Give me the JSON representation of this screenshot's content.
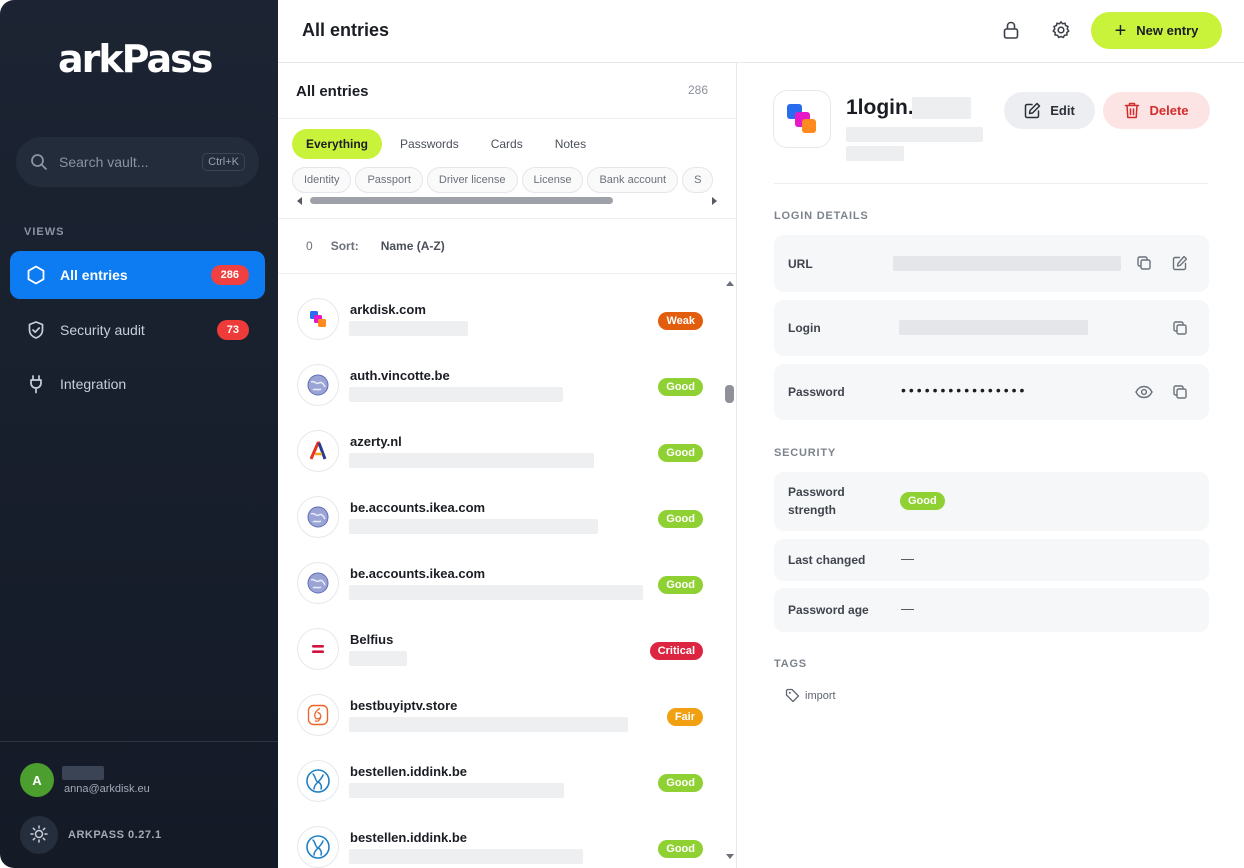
{
  "app": {
    "logo_text": "arkPass",
    "version": "ARKPASS 0.27.1"
  },
  "sidebar": {
    "search_placeholder": "Search vault...",
    "search_shortcut": "Ctrl+K",
    "views_label": "VIEWS",
    "items": [
      {
        "label": "All entries",
        "count": "286",
        "icon": "hexagon-icon",
        "active": true
      },
      {
        "label": "Security audit",
        "count": "73",
        "icon": "shield-check-icon",
        "active": false
      },
      {
        "label": "Integration",
        "count": "",
        "icon": "plug-icon",
        "active": false
      }
    ],
    "user": {
      "avatar_letter": "A",
      "email": "anna@arkdisk.eu"
    }
  },
  "header": {
    "title": "All entries",
    "new_entry_label": "New entry",
    "lock_icon": "lock-icon",
    "settings_icon": "gear-icon"
  },
  "list": {
    "title": "All entries",
    "count": "286",
    "tabs": [
      "Everything",
      "Passwords",
      "Cards",
      "Notes"
    ],
    "active_tab": "Everything",
    "chips": [
      "Identity",
      "Passport",
      "Driver license",
      "License",
      "Bank account",
      "S"
    ],
    "sort": {
      "zero": "0",
      "label": "Sort:",
      "value": "Name (A-Z)"
    },
    "entries": [
      {
        "title": "arkdisk.com",
        "strength": "Weak",
        "icon": "arkdisk-logo-icon"
      },
      {
        "title": "auth.vincotte.be",
        "strength": "Good",
        "icon": "globe-icon"
      },
      {
        "title": "azerty.nl",
        "strength": "Good",
        "icon": "azerty-logo-icon"
      },
      {
        "title": "be.accounts.ikea.com",
        "strength": "Good",
        "icon": "globe-icon"
      },
      {
        "title": "be.accounts.ikea.com",
        "strength": "Good",
        "icon": "globe-icon"
      },
      {
        "title": "Belfius",
        "strength": "Critical",
        "icon": "belfius-logo-icon"
      },
      {
        "title": "bestbuyiptv.store",
        "strength": "Fair",
        "icon": "bestbuy-logo-icon"
      },
      {
        "title": "bestellen.iddink.be",
        "strength": "Good",
        "icon": "iddink-logo-icon"
      },
      {
        "title": "bestellen.iddink.be",
        "strength": "Good",
        "icon": "iddink-logo-icon"
      }
    ]
  },
  "detail": {
    "title": "1login.",
    "edit_label": "Edit",
    "delete_label": "Delete",
    "login_details_label": "LOGIN DETAILS",
    "url_label": "URL",
    "login_label": "Login",
    "password_label": "Password",
    "password_mask": "••••••••••••••••",
    "security_label": "SECURITY",
    "strength_label": "Password strength",
    "strength_value": "Good",
    "last_changed_label": "Last changed",
    "last_changed_value": "—",
    "age_label": "Password age",
    "age_value": "—",
    "tags_label": "TAGS",
    "tag": "import"
  },
  "colors": {
    "accent": "#c9f23a",
    "primary_blue": "#0d7cf2",
    "danger": "#dc2540",
    "good": "#8fd133",
    "fair": "#f0a010",
    "weak": "#e35d0e"
  }
}
